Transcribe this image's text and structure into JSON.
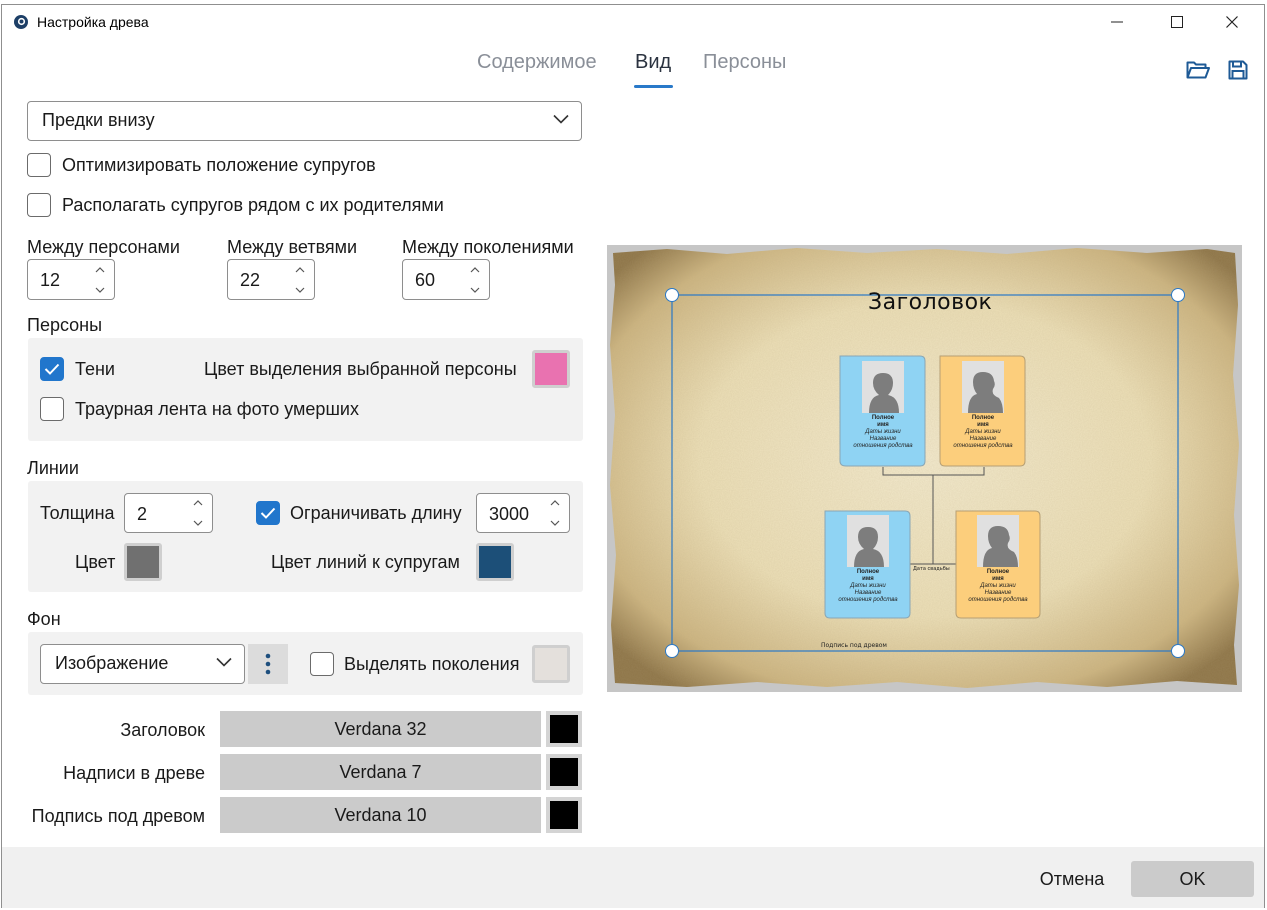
{
  "window": {
    "title": "Настройка древа"
  },
  "tabs": [
    {
      "label": "Содержимое",
      "active": false
    },
    {
      "label": "Вид",
      "active": true
    },
    {
      "label": "Персоны",
      "active": false
    }
  ],
  "layout_select": {
    "value": "Предки внизу"
  },
  "options": {
    "optimize_spouses": {
      "label": "Оптимизировать положение супругов",
      "checked": false
    },
    "spouses_near_parents": {
      "label": "Располагать супругов рядом с их родителями",
      "checked": false
    }
  },
  "spacing": {
    "persons": {
      "label": "Между персонами",
      "value": "12"
    },
    "branches": {
      "label": "Между ветвями",
      "value": "22"
    },
    "generations": {
      "label": "Между поколениями",
      "value": "60"
    }
  },
  "persons_section": {
    "title": "Персоны",
    "shadows": {
      "label": "Тени",
      "checked": true
    },
    "mourning_ribbon": {
      "label": "Траурная лента на фото умерших",
      "checked": false
    },
    "highlight_color": {
      "label": "Цвет выделения выбранной персоны",
      "color": "#e972b0"
    }
  },
  "lines_section": {
    "title": "Линии",
    "thickness": {
      "label": "Толщина",
      "value": "2"
    },
    "limit_length": {
      "label": "Ограничивать длину",
      "checked": true,
      "value": "3000"
    },
    "color": {
      "label": "Цвет",
      "color": "#707070"
    },
    "spouse_line_color": {
      "label": "Цвет линий к супругам",
      "color": "#1c4f78"
    }
  },
  "background_section": {
    "title": "Фон",
    "type": "Изображение",
    "highlight_generations": {
      "label": "Выделять поколения",
      "checked": false,
      "color": "#e4e0dc"
    }
  },
  "fonts": [
    {
      "label": "Заголовок",
      "value": "Verdana 32",
      "color": "#000000"
    },
    {
      "label": "Надписи в древе",
      "value": "Verdana 7",
      "color": "#000000"
    },
    {
      "label": "Подпись под древом",
      "value": "Verdana 10",
      "color": "#000000"
    }
  ],
  "preview": {
    "title": "Заголовок",
    "caption": "Подпись под древом",
    "wedding_label": "Дата свадьбы",
    "card_name": "Полное имя",
    "card_name_line1": "Полное",
    "card_name_line2": "имя",
    "card_dates": "Даты жизни",
    "card_relation_line1": "Название",
    "card_relation_line2": "отношения родства",
    "male_color": "#8fd3f3",
    "female_color": "#fcce7c"
  },
  "footer": {
    "cancel": "Отмена",
    "ok": "OK"
  }
}
